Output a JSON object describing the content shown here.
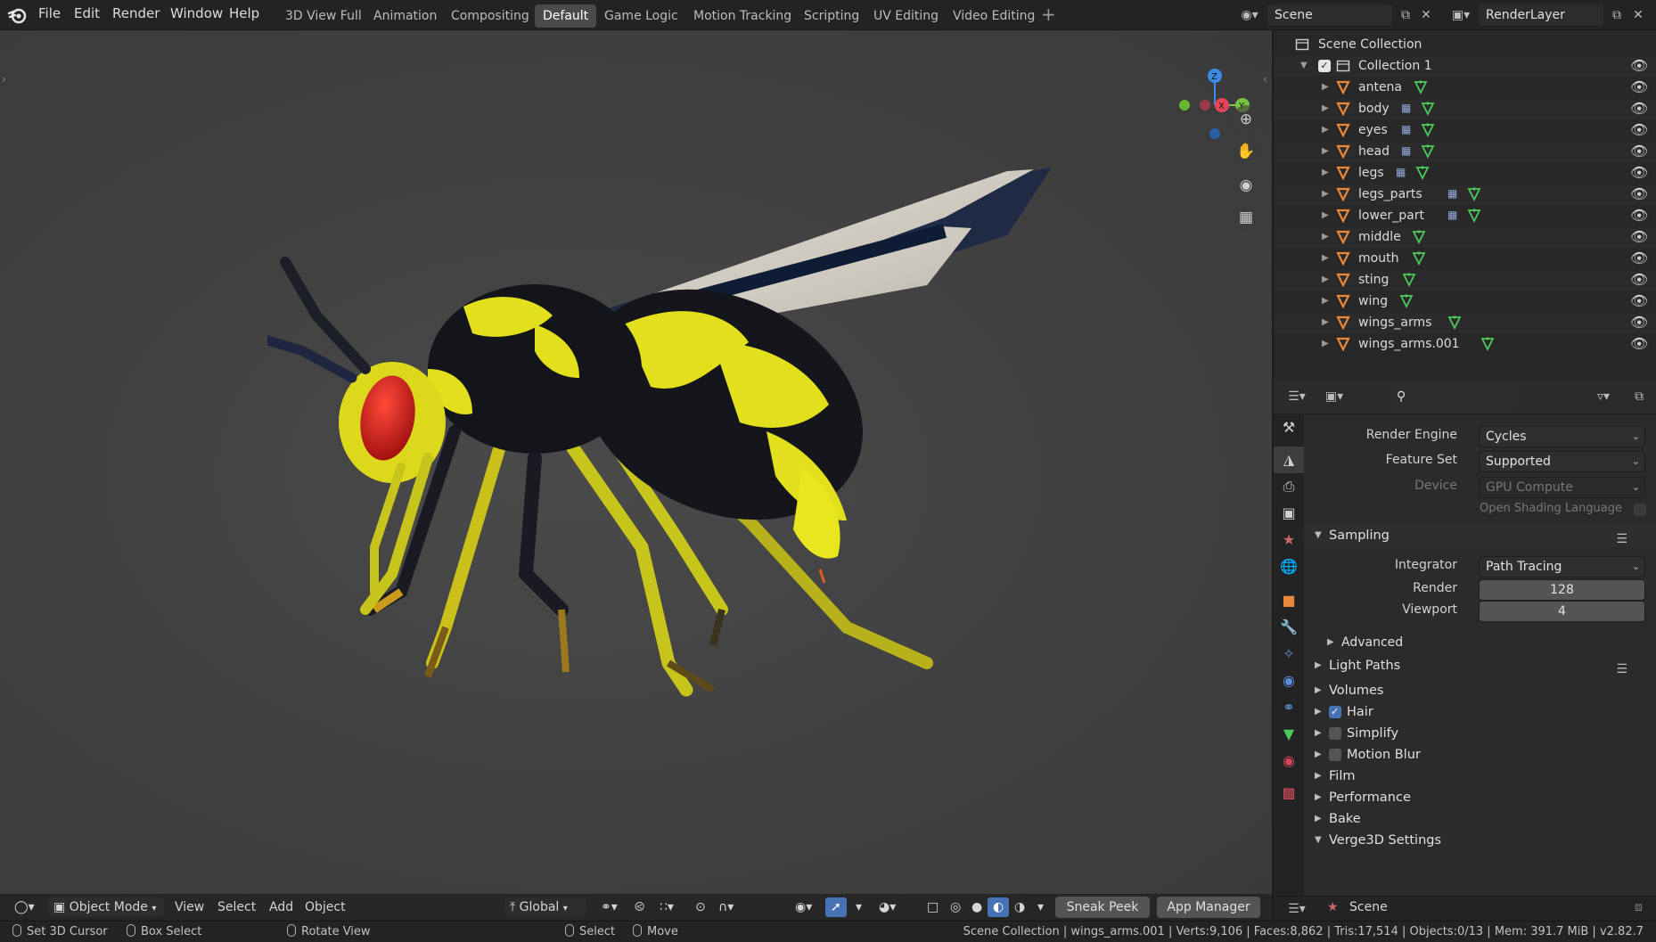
{
  "topbar": {
    "menus": [
      "File",
      "Edit",
      "Render",
      "Window",
      "Help"
    ],
    "workspaces": [
      "3D View Full",
      "Animation",
      "Compositing",
      "Default",
      "Game Logic",
      "Motion Tracking",
      "Scripting",
      "UV Editing",
      "Video Editing"
    ],
    "active_workspace": "Default",
    "add_tab": "+",
    "scene_name": "Scene",
    "view_layer_name": "RenderLayer"
  },
  "viewport": {
    "gizmo": {
      "x": "X",
      "y": "Y",
      "z": "Z"
    },
    "header": {
      "mode": "Object Mode",
      "menus": [
        "View",
        "Select",
        "Add",
        "Object"
      ],
      "orientation": "Global",
      "sneak_peek": "Sneak Peek",
      "app_manager": "App Manager"
    }
  },
  "outliner": {
    "scene_collection": "Scene Collection",
    "collection": "Collection 1",
    "objects": [
      {
        "name": "antena",
        "modifier": false
      },
      {
        "name": "body",
        "modifier": true
      },
      {
        "name": "eyes",
        "modifier": true
      },
      {
        "name": "head",
        "modifier": true
      },
      {
        "name": "legs",
        "modifier": true
      },
      {
        "name": "legs_parts",
        "modifier": true
      },
      {
        "name": "lower_part",
        "modifier": true
      },
      {
        "name": "middle",
        "modifier": false
      },
      {
        "name": "mouth",
        "modifier": false
      },
      {
        "name": "sting",
        "modifier": false
      },
      {
        "name": "wing",
        "modifier": false
      },
      {
        "name": "wings_arms",
        "modifier": false
      },
      {
        "name": "wings_arms.001",
        "modifier": false
      }
    ]
  },
  "properties": {
    "render_engine_label": "Render Engine",
    "render_engine": "Cycles",
    "feature_set_label": "Feature Set",
    "feature_set": "Supported",
    "device_label": "Device",
    "device": "GPU Compute",
    "osl_label": "Open Shading Language",
    "sampling": "Sampling",
    "integrator_label": "Integrator",
    "integrator": "Path Tracing",
    "render_label": "Render",
    "render_samples": "128",
    "viewport_label": "Viewport",
    "viewport_samples": "4",
    "advanced": "Advanced",
    "sections": [
      {
        "title": "Light Paths",
        "checkbox": null,
        "list": true
      },
      {
        "title": "Volumes",
        "checkbox": null,
        "list": false
      },
      {
        "title": "Hair",
        "checkbox": true,
        "list": false
      },
      {
        "title": "Simplify",
        "checkbox": false,
        "list": false
      },
      {
        "title": "Motion Blur",
        "checkbox": false,
        "list": false
      },
      {
        "title": "Film",
        "checkbox": null,
        "list": false
      },
      {
        "title": "Performance",
        "checkbox": null,
        "list": false
      },
      {
        "title": "Bake",
        "checkbox": null,
        "list": false
      },
      {
        "title": "Verge3D Settings",
        "checkbox": null,
        "list": false,
        "open": true
      }
    ],
    "footer_scene": "Scene"
  },
  "statusbar": {
    "set_cursor": "Set 3D Cursor",
    "box_select": "Box Select",
    "rotate_view": "Rotate View",
    "select": "Select",
    "move": "Move",
    "info": "Scene Collection | wings_arms.001 | Verts:9,106 | Faces:8,862 | Tris:17,514 | Objects:0/13 | Mem: 391.7 MiB | v2.82.7"
  },
  "colors": {
    "accent": "#4772b3",
    "mesh_icon": "#e8883a",
    "data_icon": "#4cc95a",
    "wasp_yellow": "#e8e61e",
    "wasp_black": "#15161c",
    "eye_red": "#c41616"
  }
}
